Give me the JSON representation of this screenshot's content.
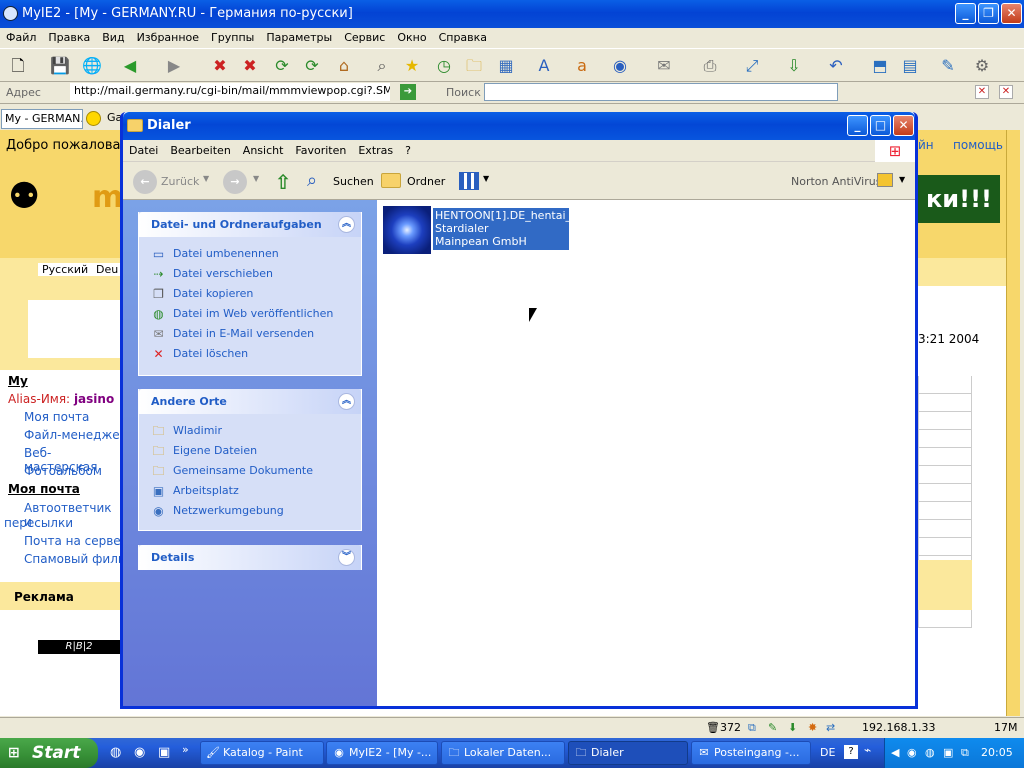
{
  "ie": {
    "title": "MyIE2 - [My - GERMANY.RU - Германия по-русски]",
    "menu": [
      "Файл",
      "Правка",
      "Вид",
      "Избранное",
      "Группы",
      "Параметры",
      "Сервис",
      "Окно",
      "Справка"
    ],
    "address_label": "Адрес",
    "address_value": "http://mail.germany.ru/cgi-bin/mail/mmmviewpop.cgi?.SME.iUP",
    "search_label": "Поиск",
    "tab_label": "My - GERMAN...",
    "tab2_label": "Ga"
  },
  "page": {
    "welcome": "Добро пожаловать,",
    "top_links": [
      "йн",
      "помощь"
    ],
    "lang_ru": "Русский",
    "lang_de": "Deu",
    "banner_text": "ки!!!",
    "date_fragment": "3:21 2004",
    "logo_fragment": "my",
    "sidebar": {
      "heading_my": "My",
      "alias_label": "Alias-Имя:",
      "alias_value": "jasino",
      "items_a": [
        "Моя почта",
        "Файл-менеджер",
        "Веб-мастерская",
        "Фотоальбом"
      ],
      "heading_mail": "Моя почта",
      "autoresponder_line1": "Автоответчик и",
      "autoresponder_line2": "пересылки",
      "items_b": [
        "Почта на сервере",
        "Спамовый фильт"
      ],
      "ads_heading": "Реклама",
      "ad_text": "R|B|2"
    }
  },
  "explorer": {
    "title": "Dialer",
    "menu": [
      "Datei",
      "Bearbeiten",
      "Ansicht",
      "Favoriten",
      "Extras",
      "?"
    ],
    "toolbar": {
      "back": "Zurück",
      "search": "Suchen",
      "folders": "Ordner",
      "norton": "Norton AntiVirus"
    },
    "tasks_panel": {
      "title": "Datei- und Ordneraufgaben",
      "items": [
        {
          "label": "Datei umbenennen",
          "icon": "rename-icon"
        },
        {
          "label": "Datei verschieben",
          "icon": "move-icon"
        },
        {
          "label": "Datei kopieren",
          "icon": "copy-icon"
        },
        {
          "label": "Datei im Web veröffentlichen",
          "icon": "publish-web-icon"
        },
        {
          "label": "Datei in E-Mail versenden",
          "icon": "email-icon"
        },
        {
          "label": "Datei löschen",
          "icon": "delete-icon"
        }
      ]
    },
    "places_panel": {
      "title": "Andere Orte",
      "items": [
        {
          "label": "Wladimir",
          "icon": "folder-icon"
        },
        {
          "label": "Eigene Dateien",
          "icon": "documents-icon"
        },
        {
          "label": "Gemeinsame Dokumente",
          "icon": "folder-icon"
        },
        {
          "label": "Arbeitsplatz",
          "icon": "computer-icon"
        },
        {
          "label": "Netzwerkumgebung",
          "icon": "network-icon"
        }
      ]
    },
    "details_panel": {
      "title": "Details"
    },
    "file": {
      "name": "HENTOON[1].DE_hentai_de",
      "type": "Stardialer",
      "company": "Mainpean GmbH"
    }
  },
  "statusbar": {
    "count": "372",
    "ip": "192.168.1.33",
    "memory": "17M"
  },
  "taskbar": {
    "start": "Start",
    "tasks": [
      {
        "label": "Katalog - Paint",
        "active": false
      },
      {
        "label": "MyIE2 - [My -...",
        "active": false
      },
      {
        "label": "Lokaler Daten...",
        "active": false
      },
      {
        "label": "Dialer",
        "active": true
      },
      {
        "label": "Posteingang -...",
        "active": false
      }
    ],
    "lang": "DE",
    "clock": "20:05"
  },
  "colors": {
    "xp_blue": "#0a5fe6",
    "task_pane": "#6375d6",
    "link_blue": "#215dc6",
    "selection": "#316ac5"
  }
}
